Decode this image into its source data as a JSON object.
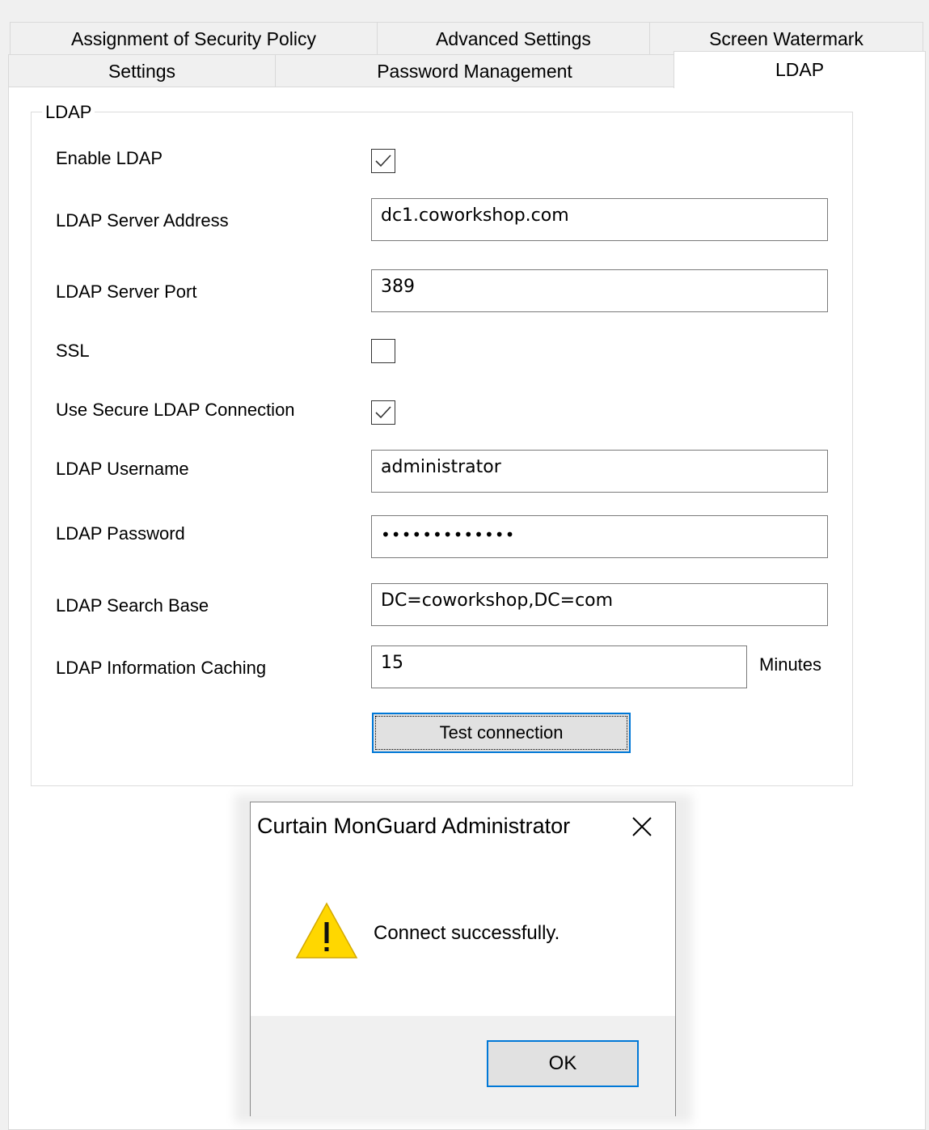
{
  "tabs": {
    "row1": [
      "Assignment of Security Policy",
      "Advanced Settings",
      "Screen Watermark"
    ],
    "row2": [
      "Settings",
      "Password Management",
      "LDAP"
    ],
    "active": "LDAP"
  },
  "group": {
    "legend": "LDAP"
  },
  "form": {
    "enable_ldap": {
      "label": "Enable LDAP",
      "checked": true
    },
    "server_address": {
      "label": "LDAP Server Address",
      "value": "dc1.coworkshop.com"
    },
    "server_port": {
      "label": "LDAP Server Port",
      "value": "389"
    },
    "ssl": {
      "label": "SSL",
      "checked": false
    },
    "secure_connection": {
      "label": "Use Secure LDAP Connection",
      "checked": true
    },
    "username": {
      "label": "LDAP Username",
      "value": "administrator"
    },
    "password": {
      "label": "LDAP Password",
      "value": "•••••••••••••"
    },
    "search_base": {
      "label": "LDAP Search Base",
      "value": "DC=coworkshop,DC=com"
    },
    "caching": {
      "label": "LDAP Information Caching",
      "value": "15",
      "unit": "Minutes"
    },
    "test_button": "Test connection"
  },
  "dialog": {
    "title": "Curtain MonGuard Administrator",
    "message": "Connect successfully.",
    "ok_label": "OK",
    "icon": "warning-icon",
    "icon_color": "#ffd700"
  }
}
